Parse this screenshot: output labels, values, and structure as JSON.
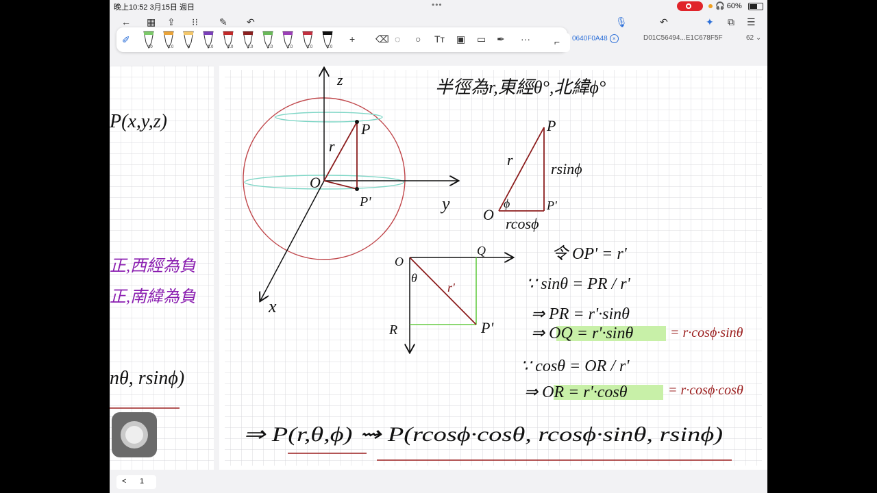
{
  "status": {
    "time": "晚上10:52  3月15日 週日",
    "battery": "60%"
  },
  "tabs": [
    {
      "label": "0640F0A48",
      "active": true
    },
    {
      "label": "D01C56494...E1C678F5F",
      "active": false
    },
    {
      "label": "62",
      "active": false
    }
  ],
  "toolbar": {
    "pens": [
      {
        "color": "#7cc86a",
        "size": "10"
      },
      {
        "color": "#e8a33a",
        "size": "1.0"
      },
      {
        "color": "#f2c66b",
        "size": "5"
      },
      {
        "color": "#7a3fb8",
        "size": "1.0"
      },
      {
        "color": "#c02a2a",
        "size": "1.0"
      },
      {
        "color": "#8a2020",
        "size": "1.0"
      },
      {
        "color": "#6ab85a",
        "size": "1.0"
      },
      {
        "color": "#9b3fb6",
        "size": "1.0"
      },
      {
        "color": "#c03040",
        "size": "1.0"
      },
      {
        "color": "#111111",
        "size": "1.0"
      }
    ],
    "add": "+",
    "more": "···"
  },
  "notes": {
    "header": "半徑為r,東經θ°,北緯ϕ°",
    "left_point": "P(x,y,z)",
    "left_rule_1": "正,西經為負",
    "left_rule_2": "正,南緯為負",
    "left_bottom": "nθ, rsinϕ)",
    "axis_z": "z",
    "axis_y": "y",
    "axis_x": "x",
    "origin": "O",
    "p": "P",
    "p_prime": "P'",
    "r": "r",
    "tri_side": "rsinϕ",
    "tri_base": "rcosϕ",
    "phi": "ϕ",
    "sq_q": "Q",
    "sq_r": "R",
    "sq_theta": "θ",
    "sq_rp": "r'",
    "let": "令 OP' = r'",
    "eq1": "∵ sinθ = PR / r'",
    "eq2": "⇒ PR = r'·sinθ",
    "eq3": "⇒ OQ = r'·sinθ",
    "eq3b": "= r·cosϕ·sinθ",
    "eq4": "∵ cosθ = OR / r'",
    "eq5": "⇒ OR = r'·cosθ",
    "eq5b": "= r·cosϕ·cosθ",
    "final": "⇒ P(r,θ,ϕ) ⇝ P(rcosϕ·cosθ, rcosϕ·sinθ, rsinϕ)"
  },
  "pager": {
    "prev": "<",
    "page": "1"
  }
}
